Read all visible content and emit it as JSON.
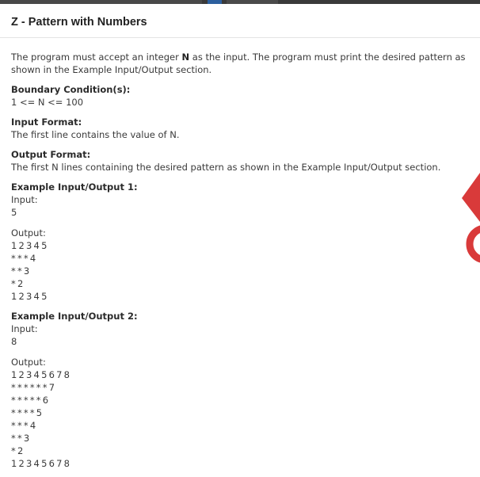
{
  "problem": {
    "title": "Z - Pattern with Numbers",
    "description_parts": [
      "The program must accept an integer ",
      "N",
      " as the input. The program must print the desired pattern as shown in the Example Input/Output section."
    ],
    "boundary": {
      "heading": "Boundary Condition(s):",
      "text": "1 <= N <= 100"
    },
    "input_format": {
      "heading": "Input Format:",
      "text": "The first line contains the value of N."
    },
    "output_format": {
      "heading": "Output Format:",
      "text": "The first N lines containing the desired pattern as shown in the Example Input/Output section."
    },
    "examples": [
      {
        "heading": "Example Input/Output 1:",
        "input_label": "Input:",
        "input_value": "5",
        "output_label": "Output:",
        "output_lines": [
          "12345",
          "***4",
          "**3",
          "*2",
          "12345"
        ]
      },
      {
        "heading": "Example Input/Output 2:",
        "input_label": "Input:",
        "input_value": "8",
        "output_label": "Output:",
        "output_lines": [
          "12345678",
          "******7",
          "*****6",
          "****5",
          "***4",
          "**3",
          "*2",
          "12345678"
        ]
      }
    ]
  },
  "colors": {
    "logo_red": "#d93a3a",
    "title_text": "#222222",
    "body_text": "#3a3a3a"
  }
}
